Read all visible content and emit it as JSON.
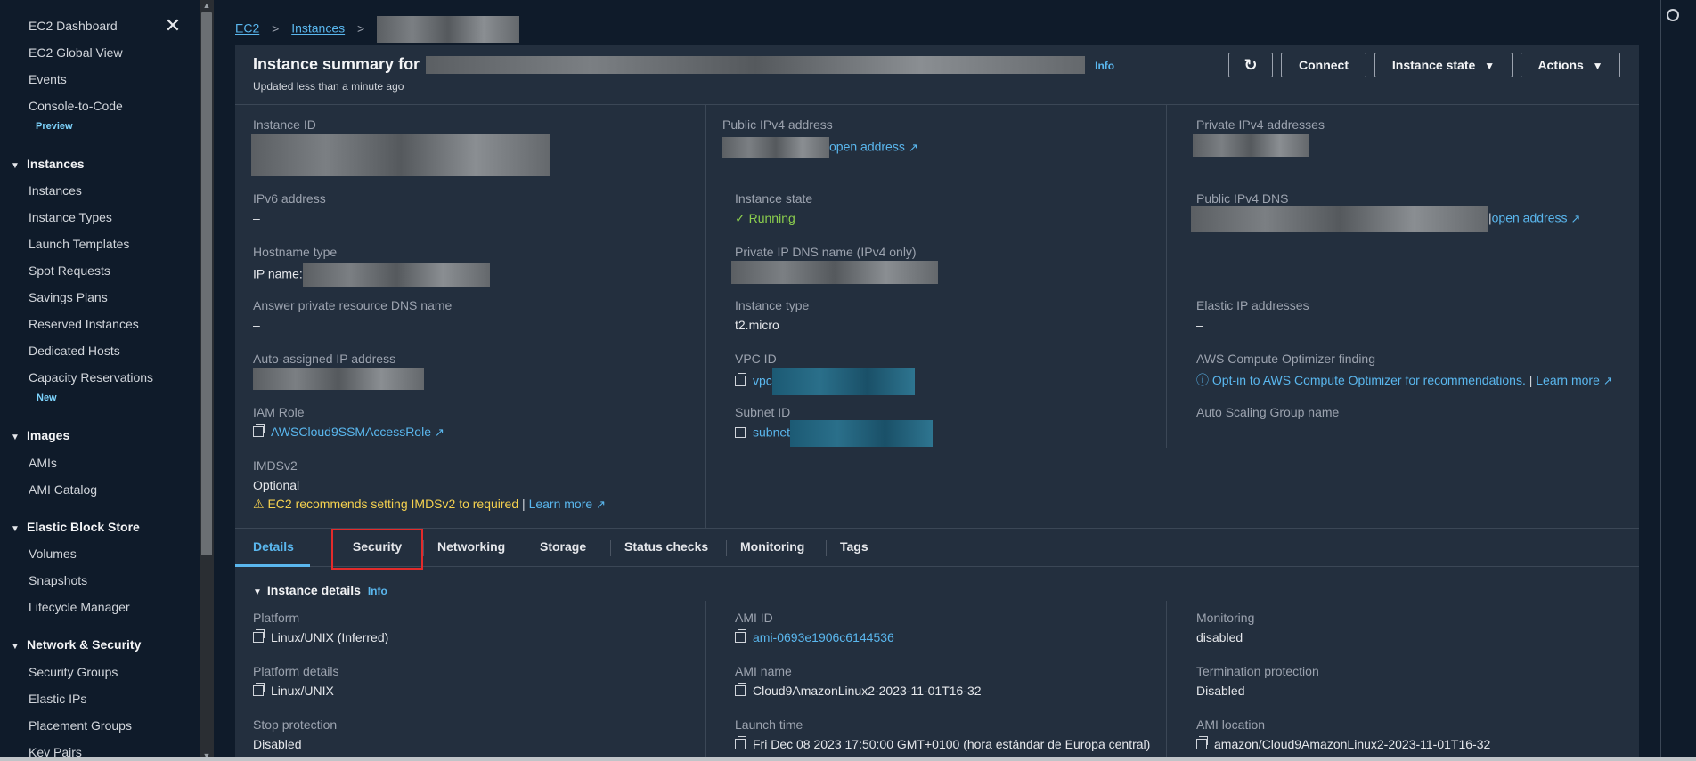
{
  "sidebar": {
    "top_items": [
      {
        "label": "EC2 Dashboard"
      },
      {
        "label": "EC2 Global View"
      },
      {
        "label": "Events"
      },
      {
        "label": "Console-to-Code"
      }
    ],
    "preview_badge": "Preview",
    "new_badge": "New",
    "sections": [
      {
        "title": "Instances",
        "items": [
          "Instances",
          "Instance Types",
          "Launch Templates",
          "Spot Requests",
          "Savings Plans",
          "Reserved Instances",
          "Dedicated Hosts",
          "Capacity Reservations"
        ]
      },
      {
        "title": "Images",
        "items": [
          "AMIs",
          "AMI Catalog"
        ]
      },
      {
        "title": "Elastic Block Store",
        "items": [
          "Volumes",
          "Snapshots",
          "Lifecycle Manager"
        ]
      },
      {
        "title": "Network & Security",
        "items": [
          "Security Groups",
          "Elastic IPs",
          "Placement Groups",
          "Key Pairs"
        ]
      }
    ]
  },
  "breadcrumb": {
    "root": "EC2",
    "instances": "Instances"
  },
  "header": {
    "title_prefix": "Instance summary for",
    "info": "Info",
    "updated": "Updated less than a minute ago",
    "buttons": {
      "refresh": "↻",
      "connect": "Connect",
      "instance_state": "Instance state",
      "actions": "Actions"
    }
  },
  "summary": {
    "instance_id_label": "Instance ID",
    "ipv6_label": "IPv6 address",
    "ipv6_value": "–",
    "hostname_label": "Hostname type",
    "hostname_value": "IP name:",
    "answer_dns_label": "Answer private resource DNS name",
    "answer_dns_value": "–",
    "auto_ip_label": "Auto-assigned IP address",
    "iam_role_label": "IAM Role",
    "iam_role_value": "AWSCloud9SSMAccessRole",
    "imds_label": "IMDSv2",
    "imds_value": "Optional",
    "imds_warning": "EC2 recommends setting IMDSv2 to required",
    "learn_more": "Learn more",
    "public_ipv4_label": "Public IPv4 address",
    "open_address": "open address",
    "instance_state_label": "Instance state",
    "instance_state_value": "Running",
    "private_dns_label": "Private IP DNS name (IPv4 only)",
    "instance_type_label": "Instance type",
    "instance_type_value": "t2.micro",
    "vpc_label": "VPC ID",
    "vpc_value": "vpc",
    "subnet_label": "Subnet ID",
    "subnet_value": "subnet",
    "private_ipv4_label": "Private IPv4 addresses",
    "public_dns_label": "Public IPv4 DNS",
    "open_address2": "open address",
    "elastic_ip_label": "Elastic IP addresses",
    "elastic_ip_value": "–",
    "optimizer_label": "AWS Compute Optimizer finding",
    "optimizer_value": "Opt-in to AWS Compute Optimizer for recommendations.",
    "optimizer_learn": "Learn more",
    "asg_label": "Auto Scaling Group name",
    "asg_value": "–"
  },
  "tabs": [
    "Details",
    "Security",
    "Networking",
    "Storage",
    "Status checks",
    "Monitoring",
    "Tags"
  ],
  "details": {
    "section_title": "Instance details",
    "info": "Info",
    "platform_label": "Platform",
    "platform_value": "Linux/UNIX (Inferred)",
    "platform_details_label": "Platform details",
    "platform_details_value": "Linux/UNIX",
    "stop_protection_label": "Stop protection",
    "stop_protection_value": "Disabled",
    "ami_id_label": "AMI ID",
    "ami_id_value": "ami-0693e1906c6144536",
    "ami_name_label": "AMI name",
    "ami_name_value": "Cloud9AmazonLinux2-2023-11-01T16-32",
    "launch_time_label": "Launch time",
    "launch_time_value": "Fri Dec 08 2023 17:50:00 GMT+0100 (hora estándar de Europa central)",
    "monitoring_label": "Monitoring",
    "monitoring_value": "disabled",
    "termination_label": "Termination protection",
    "termination_value": "Disabled",
    "ami_location_label": "AMI location",
    "ami_location_value": "amazon/Cloud9AmazonLinux2-2023-11-01T16-32"
  },
  "colors": {
    "link": "#5ab7ee",
    "running": "#8ccf4e",
    "warning": "#f5d14f",
    "highlight": "#e22b2b"
  }
}
